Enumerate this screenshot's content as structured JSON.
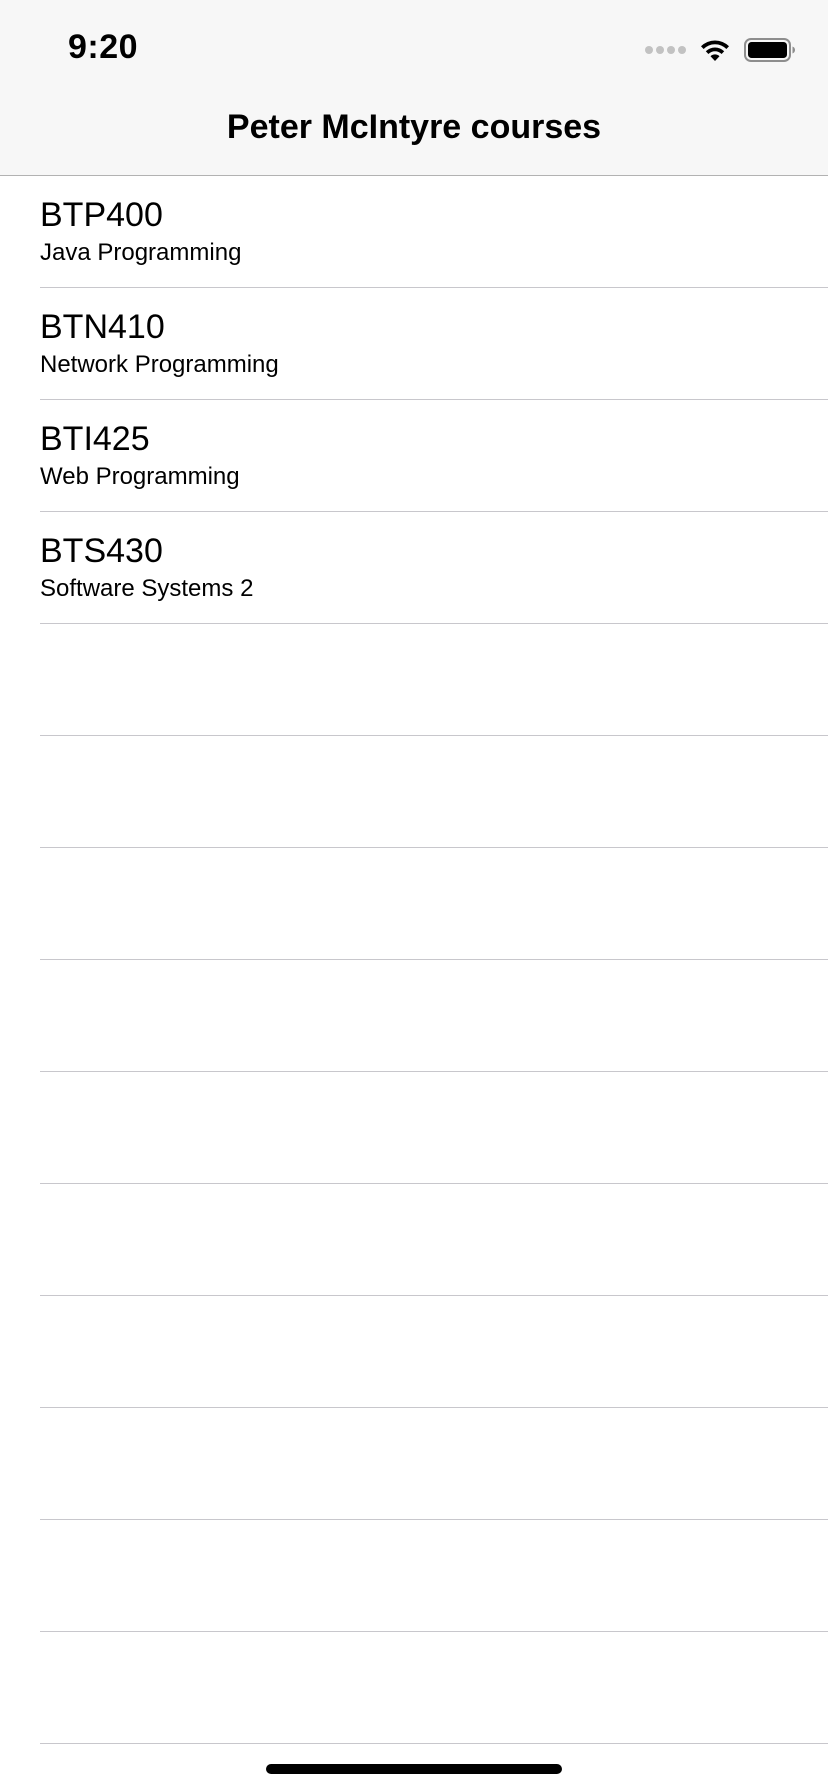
{
  "status_bar": {
    "time": "9:20",
    "icons": [
      "cellular-signal-icon",
      "wifi-icon",
      "battery-icon"
    ]
  },
  "nav": {
    "title": "Peter McIntyre courses"
  },
  "courses": [
    {
      "code": "BTP400",
      "name": "Java Programming"
    },
    {
      "code": "BTN410",
      "name": "Network Programming"
    },
    {
      "code": "BTI425",
      "name": "Web Programming"
    },
    {
      "code": "BTS430",
      "name": "Software Systems 2"
    }
  ],
  "colors": {
    "nav_background": "#f7f7f7",
    "separator": "#c8c7cc",
    "text": "#000000"
  }
}
